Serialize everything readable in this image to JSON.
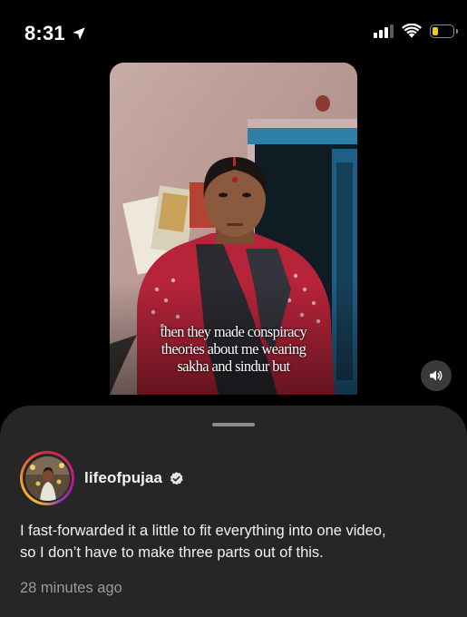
{
  "status_bar": {
    "time": "8:31",
    "location_icon": "location-arrow-icon",
    "signal_icon": "cellular-signal-icon",
    "wifi_icon": "wifi-icon",
    "battery_icon": "battery-icon",
    "battery_level": 0.3,
    "battery_color": "#f4cc0b"
  },
  "video": {
    "caption_lines": [
      "then they made conspiracy",
      "theories about me wearing",
      "sakha and sindur but"
    ],
    "sound_icon": "speaker-icon"
  },
  "sheet": {
    "username": "lifeofpujaa",
    "verified_icon": "verified-badge-icon",
    "caption_lines": [
      "I fast-forwarded it a little to fit everything into one video,",
      "so I don’t have to make three parts out of this."
    ],
    "timestamp": "28 minutes ago"
  },
  "colors": {
    "background": "#000000",
    "sheet": "#262626",
    "secondary_text": "#9a9a9a"
  }
}
